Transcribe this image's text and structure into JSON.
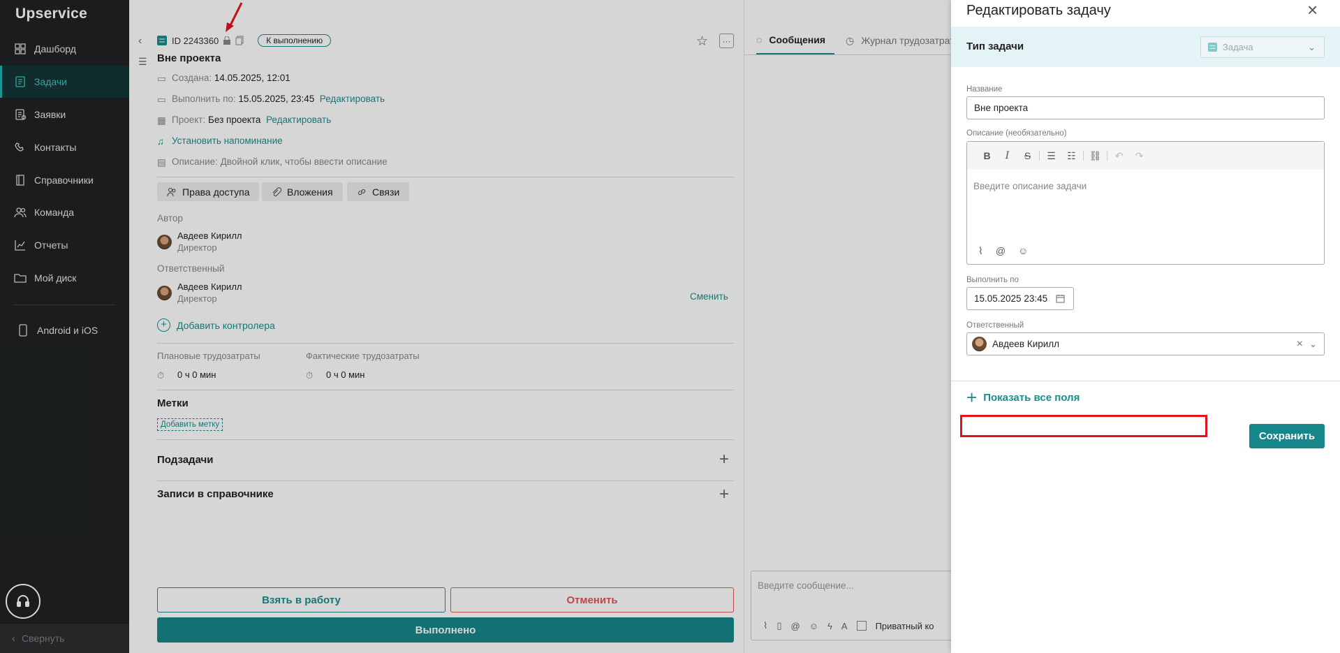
{
  "sidebar": {
    "logo": "Upservice",
    "items": [
      {
        "label": "Дашборд",
        "icon": "dashboard-icon"
      },
      {
        "label": "Задачи",
        "icon": "tasks-icon",
        "active": true
      },
      {
        "label": "Заявки",
        "icon": "requests-icon"
      },
      {
        "label": "Контакты",
        "icon": "contacts-icon"
      },
      {
        "label": "Справочники",
        "icon": "book-icon"
      },
      {
        "label": "Команда",
        "icon": "team-icon"
      },
      {
        "label": "Отчеты",
        "icon": "reports-icon"
      },
      {
        "label": "Мой диск",
        "icon": "folder-icon"
      }
    ],
    "mobile": "Android и iOS",
    "collapse": "Свернуть"
  },
  "task": {
    "id": "ID 2243360",
    "status": "К выполнению",
    "title": "Вне проекта",
    "created_label": "Создана:",
    "created_value": "14.05.2025, 12:01",
    "due_label": "Выполнить по:",
    "due_value": "15.05.2025, 23:45",
    "edit": "Редактировать",
    "project_label": "Проект:",
    "project_value": "Без проекта",
    "reminder": "Установить напоминание",
    "description": "Описание: Двойной клик, чтобы ввести описание",
    "chips": [
      "Права доступа",
      "Вложения",
      "Связи"
    ],
    "author_label": "Автор",
    "author_name": "Авдеев Кирилл",
    "author_role": "Директор",
    "assignee_label": "Ответственный",
    "assignee_name": "Авдеев Кирилл",
    "assignee_role": "Директор",
    "change": "Сменить",
    "add_controller": "Добавить контролера",
    "planned_label": "Плановые трудозатраты",
    "planned_value": "0 ч 0 мин",
    "actual_label": "Фактические трудозатраты",
    "actual_value": "0 ч 0 мин",
    "tags_label": "Метки",
    "add_tag": "Добавить метку",
    "subtasks": "Подзадачи",
    "records": "Записи в справочнике",
    "btn_take": "Взять в работу",
    "btn_cancel": "Отменить",
    "btn_done": "Выполнено"
  },
  "messages": {
    "tab_messages": "Сообщения",
    "tab_log": "Журнал трудозатрат",
    "input_placeholder": "Введите сообщение...",
    "private": "Приватный ко"
  },
  "modal": {
    "title": "Редактировать задачу",
    "type_label": "Тип задачи",
    "type_value": "Задача",
    "name_label": "Название",
    "name_value": "Вне проекта",
    "desc_label": "Описание (необязательно)",
    "desc_placeholder": "Введите описание задачи",
    "due_label": "Выполнить по",
    "due_value": "15.05.2025 23:45",
    "assignee_label": "Ответственный",
    "assignee_value": "Авдеев Кирилл",
    "show_all": "Показать все поля",
    "save": "Сохранить"
  },
  "colors": {
    "accent": "#1b8d8a",
    "sidebar": "#1f2223",
    "danger": "#e0141b",
    "save": "#17868a"
  }
}
